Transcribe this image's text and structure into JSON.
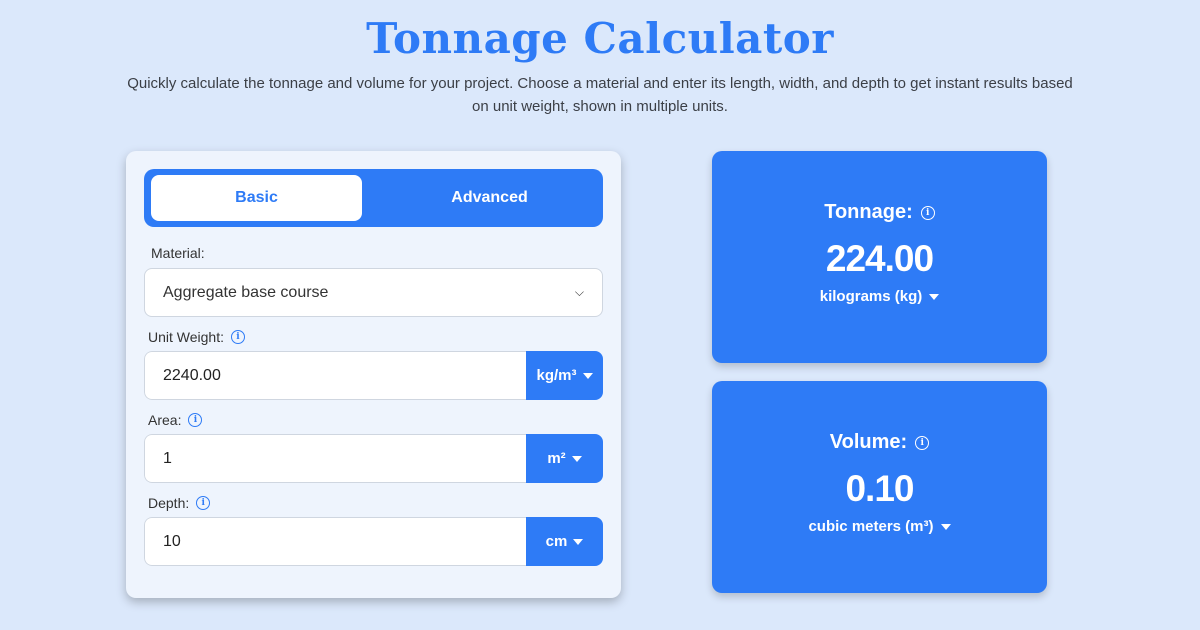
{
  "header": {
    "title": "Tonnage Calculator",
    "subtitle": "Quickly calculate the tonnage and volume for your project. Choose a material and enter its length, width, and depth to get instant results based on unit weight, shown in multiple units."
  },
  "tabs": [
    {
      "label": "Basic",
      "active": true
    },
    {
      "label": "Advanced",
      "active": false
    }
  ],
  "form": {
    "material": {
      "label": "Material:",
      "value": "Aggregate base course"
    },
    "unit_weight": {
      "label": "Unit Weight:",
      "value": "2240.00",
      "unit": "kg/m³"
    },
    "area": {
      "label": "Area:",
      "value": "1",
      "unit": "m²"
    },
    "depth": {
      "label": "Depth:",
      "value": "10",
      "unit": "cm"
    }
  },
  "results": {
    "tonnage": {
      "label": "Tonnage:",
      "value": "224.00",
      "unit": "kilograms (kg)"
    },
    "volume": {
      "label": "Volume:",
      "value": "0.10",
      "unit": "cubic meters (m³)"
    }
  },
  "colors": {
    "accent": "#2e7bf6",
    "background": "#dbe8fb",
    "card": "#eef4fd"
  },
  "icons": {
    "info": "info-icon",
    "dropdown": "caret-down-icon",
    "select": "chevron-down-icon"
  }
}
